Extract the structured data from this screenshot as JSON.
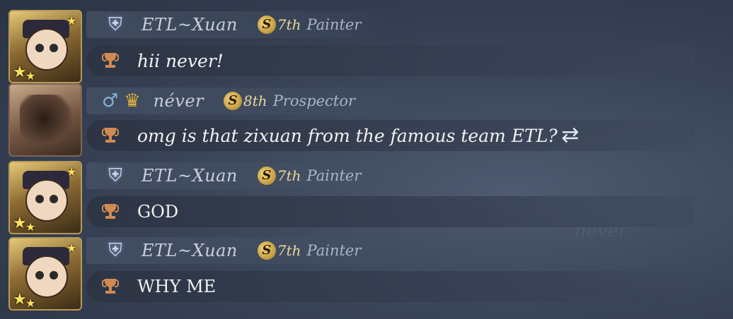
{
  "background_ghost_text": [
    "never"
  ],
  "messages": [
    {
      "sender": "ETL~Xuan",
      "badge_rank": "7th",
      "badge_coin": "S",
      "role": "Painter",
      "text": "hii never!",
      "avatar": "painter-avatar"
    },
    {
      "sender": "néver",
      "badge_rank": "8th",
      "badge_coin": "S",
      "role": "Prospector",
      "text": "omg is that zixuan from the famous team ETL?",
      "avatar": "prospector-avatar"
    },
    {
      "sender": "ETL~Xuan",
      "badge_rank": "7th",
      "badge_coin": "S",
      "role": "Painter",
      "text": "GOD",
      "avatar": "painter-avatar"
    },
    {
      "sender": "ETL~Xuan",
      "badge_rank": "7th",
      "badge_coin": "S",
      "role": "Painter",
      "text": "WHY ME",
      "avatar": "painter-avatar"
    }
  ],
  "icons": {
    "rank": "knight-helmet-icon",
    "gender": "male-icon",
    "gold": "gold-crown-icon",
    "message_prefix": "trophy-icon",
    "translate": "refresh-arrows-icon"
  }
}
